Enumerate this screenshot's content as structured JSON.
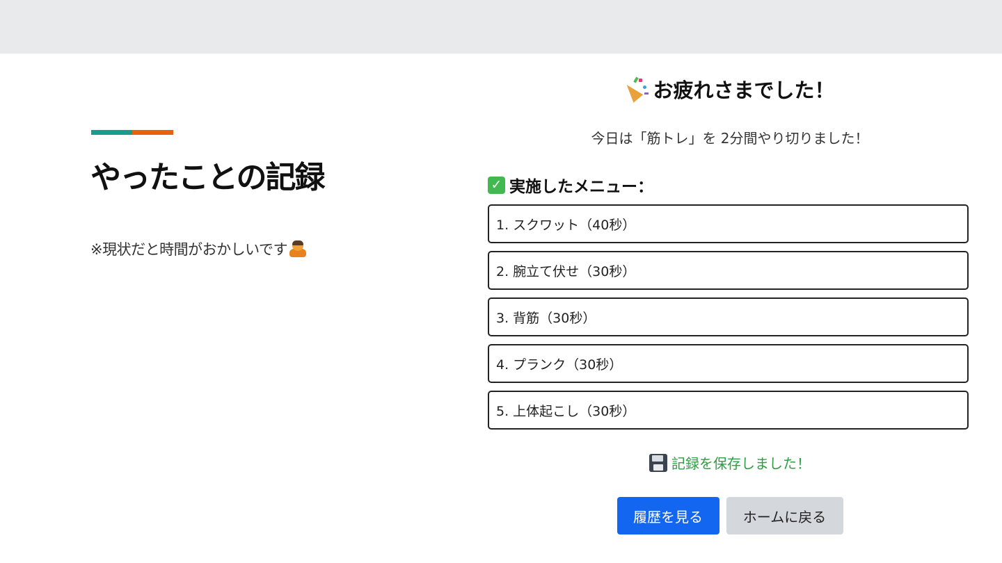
{
  "slide": {
    "title": "やったことの記録",
    "note": "※現状だと時間がおかしいです"
  },
  "panel": {
    "title": "お疲れさまでした！",
    "summary": "今日は「筋トレ」を 2分間やり切りました！",
    "menu_heading": "実施したメニュー：",
    "menu_items": [
      "1. スクワット（40秒）",
      "2. 腕立て伏せ（30秒）",
      "3. 背筋（30秒）",
      "4. プランク（30秒）",
      "5. 上体起こし（30秒）"
    ],
    "saved_message": "記録を保存しました！",
    "buttons": {
      "history": "履歴を見る",
      "home": "ホームに戻る"
    }
  },
  "colors": {
    "accent_teal": "#1a9c8c",
    "accent_orange": "#e8610f",
    "primary_button": "#1366ef",
    "secondary_button": "#d4d7dc",
    "saved_text": "#2e9d43"
  },
  "icons": {
    "title_icon": "party-popper-icon",
    "heading_icon": "check-mark-icon",
    "saved_icon": "floppy-disk-icon",
    "note_icon": "bowing-person-icon"
  }
}
